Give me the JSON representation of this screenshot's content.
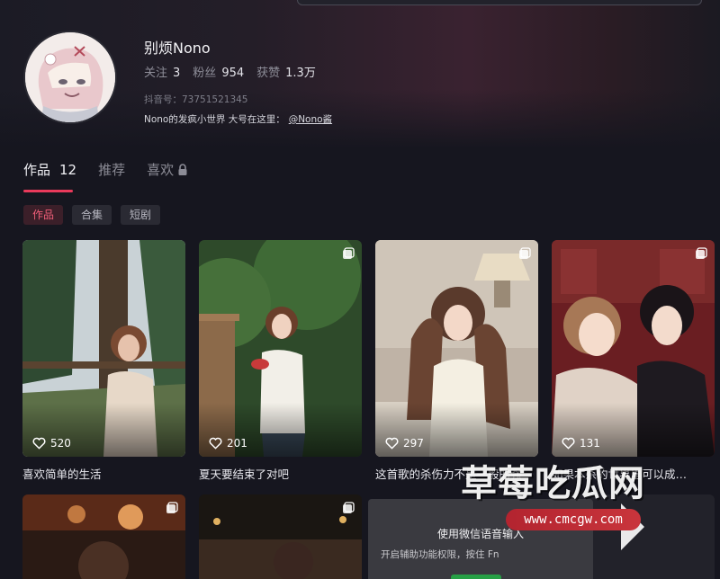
{
  "profile": {
    "name": "别烦Nono",
    "stats": [
      {
        "label": "关注",
        "value": "3"
      },
      {
        "label": "粉丝",
        "value": "954"
      },
      {
        "label": "获赞",
        "value": "1.3万"
      }
    ],
    "douyin_id": "抖音号：73751521345",
    "bio": "Nono的发疯小世界 大号在这里：",
    "bio_link": "@Nono酱"
  },
  "tabs": [
    {
      "label": "作品",
      "count": "12",
      "active": true
    },
    {
      "label": "推荐"
    },
    {
      "label": "喜欢",
      "locked": true
    }
  ],
  "filters": [
    {
      "label": "作品",
      "active": true
    },
    {
      "label": "合集"
    },
    {
      "label": "短剧"
    }
  ],
  "videos": [
    {
      "likes": "520",
      "caption": "喜欢简单的生活"
    },
    {
      "likes": "201",
      "caption": "夏天要结束了对吧"
    },
    {
      "likes": "297",
      "caption": "这首歌的杀伤力不是一般的强"
    },
    {
      "likes": "131",
      "caption": "如果本杀的世界里可以成…"
    }
  ],
  "toast": {
    "title": "使用微信语音输入",
    "subtitle": "开启辅助功能权限，按住 Fn"
  },
  "watermark": {
    "text": "草莓吃瓜网",
    "url": "www.cmcgw.com"
  },
  "colors": {
    "accent": "#ea3a5b",
    "background": "#16161f"
  }
}
